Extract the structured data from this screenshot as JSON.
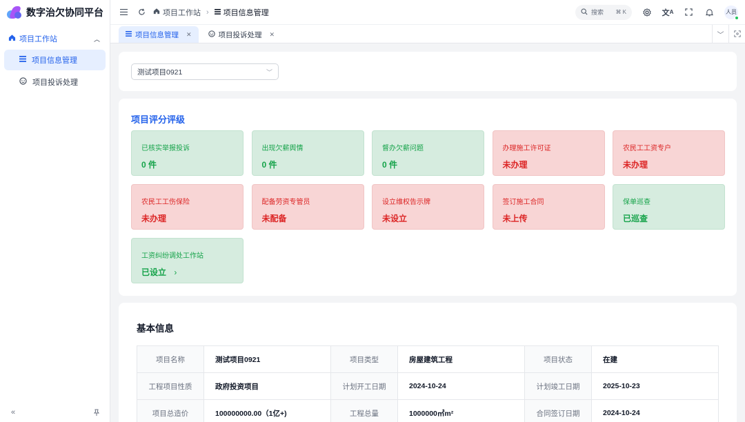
{
  "app": {
    "title": "数字治欠协同平台"
  },
  "sidebar": {
    "group_label": "项目工作站",
    "items": [
      {
        "label": "项目信息管理",
        "icon": "list-icon"
      },
      {
        "label": "项目投诉处理",
        "icon": "smile-icon"
      }
    ]
  },
  "header": {
    "breadcrumb": [
      "项目工作站",
      "项目信息管理"
    ],
    "search_label": "搜索",
    "search_shortcut": "⌘ K",
    "user_label": "人员"
  },
  "tabs": [
    {
      "label": "项目信息管理",
      "active": true
    },
    {
      "label": "项目投诉处理",
      "active": false
    }
  ],
  "project_select": {
    "value": "测试项目0921"
  },
  "rating": {
    "title": "项目评分评级",
    "cards": [
      {
        "label": "已核实举报投诉",
        "value": "0 件",
        "status": "green"
      },
      {
        "label": "出现欠薪舆情",
        "value": "0 件",
        "status": "green"
      },
      {
        "label": "督办欠薪问题",
        "value": "0 件",
        "status": "green"
      },
      {
        "label": "办理施工许可证",
        "value": "未办理",
        "status": "red"
      },
      {
        "label": "农民工工资专户",
        "value": "未办理",
        "status": "red"
      },
      {
        "label": "农民工工伤保险",
        "value": "未办理",
        "status": "red"
      },
      {
        "label": "配备劳资专管员",
        "value": "未配备",
        "status": "red"
      },
      {
        "label": "设立维权告示牌",
        "value": "未设立",
        "status": "red"
      },
      {
        "label": "签订施工合同",
        "value": "未上传",
        "status": "red"
      },
      {
        "label": "保单巡查",
        "value": "已巡查",
        "status": "green"
      },
      {
        "label": "工资纠纷调处工作站",
        "value": "已设立",
        "status": "green",
        "arrow": "›"
      }
    ]
  },
  "basic_info": {
    "title": "基本信息",
    "rows": [
      [
        {
          "k": "项目名称",
          "v": "测试项目0921"
        },
        {
          "k": "项目类型",
          "v": "房屋建筑工程"
        },
        {
          "k": "项目状态",
          "v": "在建"
        }
      ],
      [
        {
          "k": "工程项目性质",
          "v": "政府投资项目"
        },
        {
          "k": "计划开工日期",
          "v": "2024-10-24"
        },
        {
          "k": "计划竣工日期",
          "v": "2025-10-23"
        }
      ],
      [
        {
          "k": "项目总造价",
          "v": "100000000.00（1亿+)"
        },
        {
          "k": "工程总量",
          "v": "1000000㎡m²"
        },
        {
          "k": "合同签订日期",
          "v": "2024-10-24"
        }
      ]
    ]
  },
  "colors": {
    "accent": "#2563eb",
    "ok_bg": "#d6ecdf",
    "ok_text": "#16a34a",
    "bad_bg": "#f8d5d5",
    "bad_text": "#dc2626"
  }
}
